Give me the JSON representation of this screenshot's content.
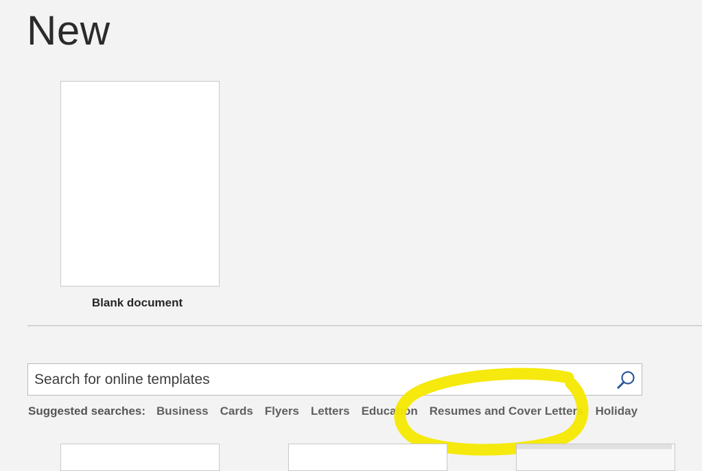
{
  "page": {
    "title": "New"
  },
  "blank_template": {
    "caption": "Blank document"
  },
  "search": {
    "placeholder": "Search for online templates",
    "icon": "search-icon"
  },
  "suggested": {
    "label": "Suggested searches:",
    "items": [
      "Business",
      "Cards",
      "Flyers",
      "Letters",
      "Education",
      "Resumes and Cover Letters",
      "Holiday"
    ]
  },
  "annotation": {
    "highlight_color": "#f4e800",
    "highlighted_item": "Resumes and Cover Letters"
  },
  "colors": {
    "background": "#f3f3f3",
    "search_icon": "#2b579a"
  }
}
